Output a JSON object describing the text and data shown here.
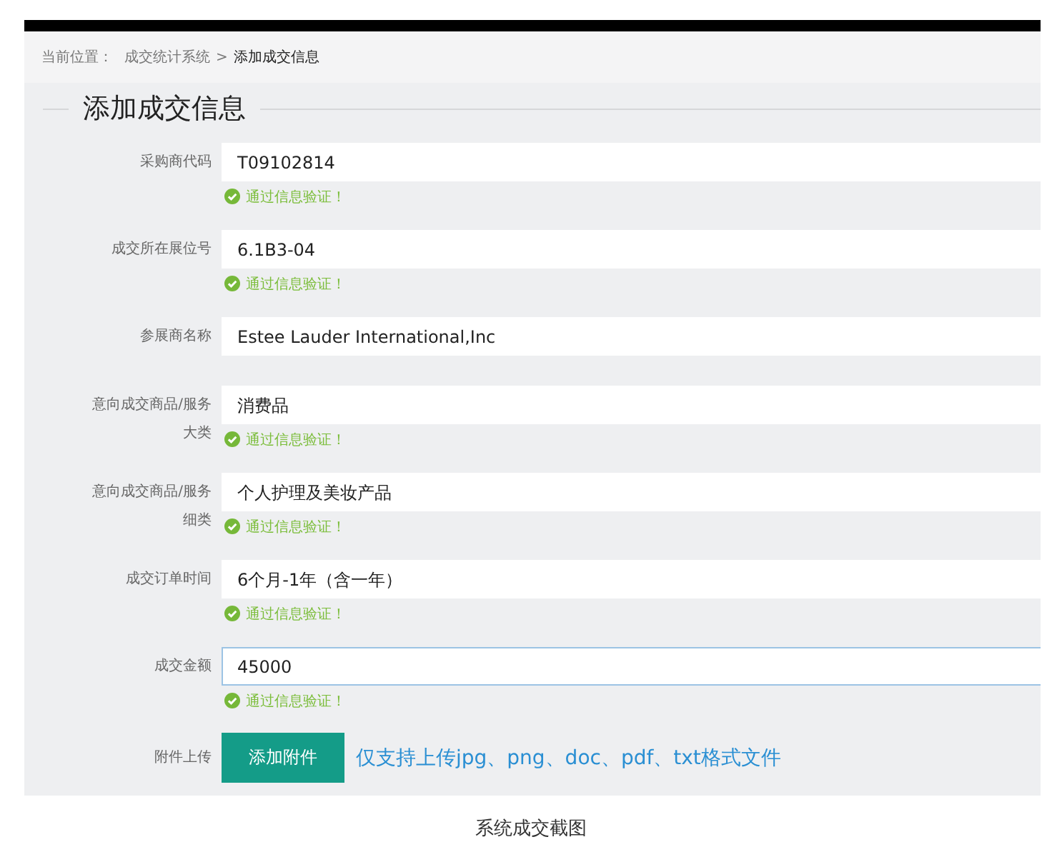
{
  "breadcrumb": {
    "label": "当前位置：",
    "path": [
      {
        "text": "成交统计系统",
        "current": false
      },
      {
        "text": "添加成交信息",
        "current": true
      }
    ],
    "separator": ">"
  },
  "title": "添加成交信息",
  "fields": [
    {
      "label": "采购商代码",
      "value": "T09102814",
      "validated": true,
      "focused": false,
      "message": "通过信息验证！"
    },
    {
      "label": "成交所在展位号",
      "value": "6.1B3-04",
      "validated": true,
      "focused": false,
      "message": "通过信息验证！"
    },
    {
      "label": "参展商名称",
      "value": "Estee Lauder International,Inc",
      "validated": false,
      "focused": false
    },
    {
      "label": "意向成交商品/服务大类",
      "value": "消费品",
      "validated": true,
      "focused": false,
      "message": "通过信息验证！"
    },
    {
      "label": "意向成交商品/服务细类",
      "value": "个人护理及美妆产品",
      "validated": true,
      "focused": false,
      "message": "通过信息验证！"
    },
    {
      "label": "成交订单时间",
      "value": "6个月-1年（含一年）",
      "validated": true,
      "focused": false,
      "message": "通过信息验证！"
    },
    {
      "label": "成交金额",
      "value": "45000",
      "validated": true,
      "focused": true,
      "message": "通过信息验证！"
    }
  ],
  "upload": {
    "label": "附件上传",
    "button": "添加附件",
    "hint": "仅支持上传jpg、png、doc、pdf、txt格式文件"
  },
  "caption": "系统成交截图"
}
